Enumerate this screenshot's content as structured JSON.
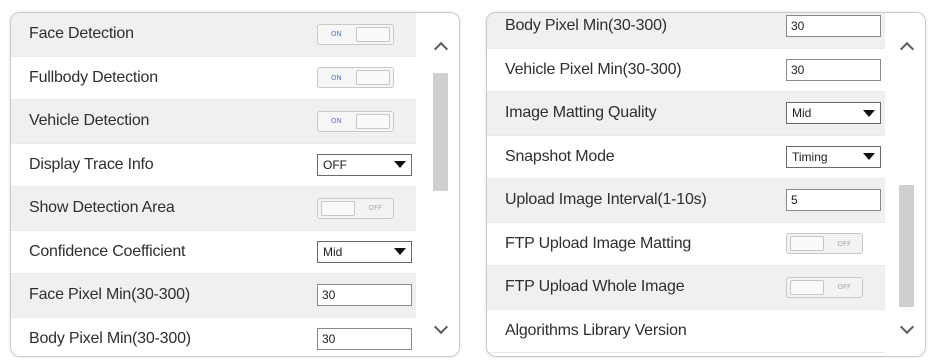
{
  "left_panel": {
    "rows": [
      {
        "label": "Face Detection",
        "type": "toggle",
        "value": "ON"
      },
      {
        "label": "Fullbody Detection",
        "type": "toggle",
        "value": "ON"
      },
      {
        "label": "Vehicle Detection",
        "type": "toggle",
        "value": "ON"
      },
      {
        "label": "Display Trace Info",
        "type": "select",
        "value": "OFF"
      },
      {
        "label": "Show Detection Area",
        "type": "toggle",
        "value": "OFF"
      },
      {
        "label": "Confidence Coefficient",
        "type": "select",
        "value": "Mid"
      },
      {
        "label": "Face Pixel Min(30-300)",
        "type": "input",
        "value": "30"
      },
      {
        "label": "Body Pixel Min(30-300)",
        "type": "input",
        "value": "30"
      }
    ],
    "scroll_up_icon": "chevron-up-icon",
    "scroll_down_icon": "chevron-down-icon"
  },
  "right_panel": {
    "rows": [
      {
        "label": "Body Pixel Min(30-300)",
        "type": "input",
        "value": "30"
      },
      {
        "label": "Vehicle Pixel Min(30-300)",
        "type": "input",
        "value": "30"
      },
      {
        "label": "Image Matting Quality",
        "type": "select",
        "value": "Mid"
      },
      {
        "label": "Snapshot Mode",
        "type": "select",
        "value": "Timing"
      },
      {
        "label": "Upload Image Interval(1-10s)",
        "type": "input",
        "value": "5"
      },
      {
        "label": "FTP Upload Image Matting",
        "type": "toggle",
        "value": "OFF"
      },
      {
        "label": "FTP Upload Whole Image",
        "type": "toggle",
        "value": "OFF"
      },
      {
        "label": "Algorithms Library Version",
        "type": "none",
        "value": ""
      }
    ],
    "scroll_up_icon": "chevron-up-icon",
    "scroll_down_icon": "chevron-down-icon"
  },
  "colors": {
    "toggle_on_text": "#5b78c8",
    "toggle_off_text": "#aaaaaa",
    "alt_row_bg": "#f0f0f0",
    "scroll_thumb": "#cfcfcf"
  }
}
